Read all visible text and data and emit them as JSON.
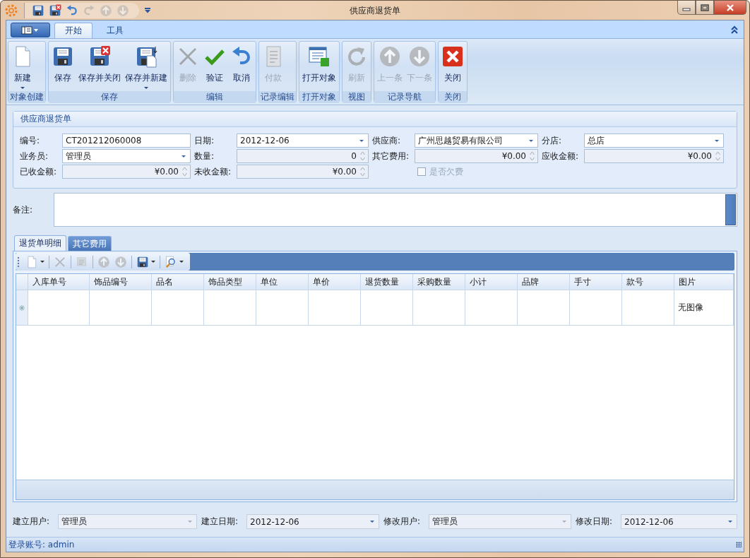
{
  "window": {
    "title": "供应商退货单"
  },
  "quick_access": [
    {
      "kind": "save",
      "disabled": false
    },
    {
      "kind": "saveclose",
      "disabled": false
    },
    {
      "kind": "undo",
      "disabled": false
    },
    {
      "kind": "redo",
      "disabled": true
    },
    {
      "kind": "up",
      "disabled": true
    },
    {
      "kind": "down",
      "disabled": true
    }
  ],
  "ribbon_tabs": [
    {
      "label": "开始",
      "selected": true
    },
    {
      "label": "工具",
      "selected": false
    }
  ],
  "ribbon_groups": [
    {
      "label": "对象创建",
      "buttons": [
        {
          "label": "新建",
          "kind": "new",
          "disabled": false,
          "dropdown": true
        }
      ]
    },
    {
      "label": "保存",
      "buttons": [
        {
          "label": "保存",
          "kind": "save",
          "disabled": false,
          "dropdown": false
        },
        {
          "label": "保存并关闭",
          "kind": "saveclose",
          "disabled": false,
          "dropdown": false
        },
        {
          "label": "保存并新建",
          "kind": "savenew",
          "disabled": false,
          "dropdown": true
        }
      ]
    },
    {
      "label": "编辑",
      "buttons": [
        {
          "label": "删除",
          "kind": "delete",
          "disabled": true,
          "dropdown": false
        },
        {
          "label": "验证",
          "kind": "validate",
          "disabled": false,
          "dropdown": false
        },
        {
          "label": "取消",
          "kind": "undo",
          "disabled": false,
          "dropdown": false
        }
      ]
    },
    {
      "label": "记录编辑",
      "buttons": [
        {
          "label": "付款",
          "kind": "payment",
          "disabled": true,
          "dropdown": false
        }
      ]
    },
    {
      "label": "打开对象",
      "buttons": [
        {
          "label": "打开对象",
          "kind": "openobj",
          "disabled": false,
          "dropdown": false
        }
      ]
    },
    {
      "label": "视图",
      "buttons": [
        {
          "label": "刷新",
          "kind": "refresh",
          "disabled": true,
          "dropdown": false
        }
      ]
    },
    {
      "label": "记录导航",
      "buttons": [
        {
          "label": "上一条",
          "kind": "up",
          "disabled": true,
          "dropdown": false
        },
        {
          "label": "下一条",
          "kind": "down",
          "disabled": true,
          "dropdown": false
        }
      ]
    },
    {
      "label": "关闭",
      "buttons": [
        {
          "label": "关闭",
          "kind": "close",
          "disabled": false,
          "dropdown": false
        }
      ]
    }
  ],
  "form": {
    "title": "供应商退货单",
    "fields": [
      {
        "label": "编号:",
        "kind": "text",
        "value": "CT201212060008",
        "disabled": false
      },
      {
        "label": "日期:",
        "kind": "dropdown",
        "value": "2012-12-06",
        "disabled": false
      },
      {
        "label": "供应商:",
        "kind": "dropdown",
        "value": "广州思越贸易有限公司",
        "disabled": false
      },
      {
        "label": "分店:",
        "kind": "dropdown",
        "value": "总店",
        "disabled": false
      },
      {
        "label": "业务员:",
        "kind": "dropdown",
        "value": "管理员",
        "disabled": false
      },
      {
        "label": "数量:",
        "kind": "spin",
        "value": "0",
        "disabled": true
      },
      {
        "label": "其它费用:",
        "kind": "spin",
        "value": "¥0.00",
        "disabled": true
      },
      {
        "label": "应收金额:",
        "kind": "spin",
        "value": "¥0.00",
        "disabled": true
      },
      {
        "label": "已收金额:",
        "kind": "spin",
        "value": "¥0.00",
        "disabled": true
      },
      {
        "label": "未收金额:",
        "kind": "spin",
        "value": "¥0.00",
        "disabled": true
      },
      {
        "label": "是否欠费",
        "kind": "checkbox",
        "checked": false,
        "disabled": true
      }
    ]
  },
  "remark": {
    "label": "备注:"
  },
  "detail_tabs": [
    {
      "label": "退货单明细",
      "selected": true
    },
    {
      "label": "其它费用",
      "selected": false
    }
  ],
  "detail_toolbar": [
    [
      {
        "kind": "new",
        "dropdown": true,
        "disabled": false
      }
    ],
    [
      {
        "kind": "delete",
        "dropdown": false,
        "disabled": true
      }
    ],
    [
      {
        "kind": "edit",
        "dropdown": false,
        "disabled": true
      }
    ],
    [
      {
        "kind": "up",
        "dropdown": false,
        "disabled": true
      },
      {
        "kind": "down",
        "dropdown": false,
        "disabled": true
      }
    ],
    [
      {
        "kind": "save",
        "dropdown": true,
        "disabled": false
      }
    ],
    [
      {
        "kind": "find",
        "dropdown": true,
        "disabled": false
      }
    ]
  ],
  "table": {
    "columns": [
      "入库单号",
      "饰品编号",
      "品名",
      "饰品类型",
      "单位",
      "单价",
      "退货数量",
      "采购数量",
      "小计",
      "品牌",
      "手寸",
      "款号",
      "图片"
    ],
    "rows": [
      {
        "new_row": true,
        "picture": "无图像"
      }
    ]
  },
  "audit_fields": [
    {
      "label": "建立用户:",
      "value": "管理员",
      "disabled": true
    },
    {
      "label": "建立日期:",
      "value": "2012-12-06",
      "disabled": false
    },
    {
      "label": "修改用户:",
      "value": "管理员",
      "disabled": true
    },
    {
      "label": "修改日期:",
      "value": "2012-12-06",
      "disabled": false
    }
  ],
  "status_bar": {
    "text": "登录账号: admin"
  }
}
